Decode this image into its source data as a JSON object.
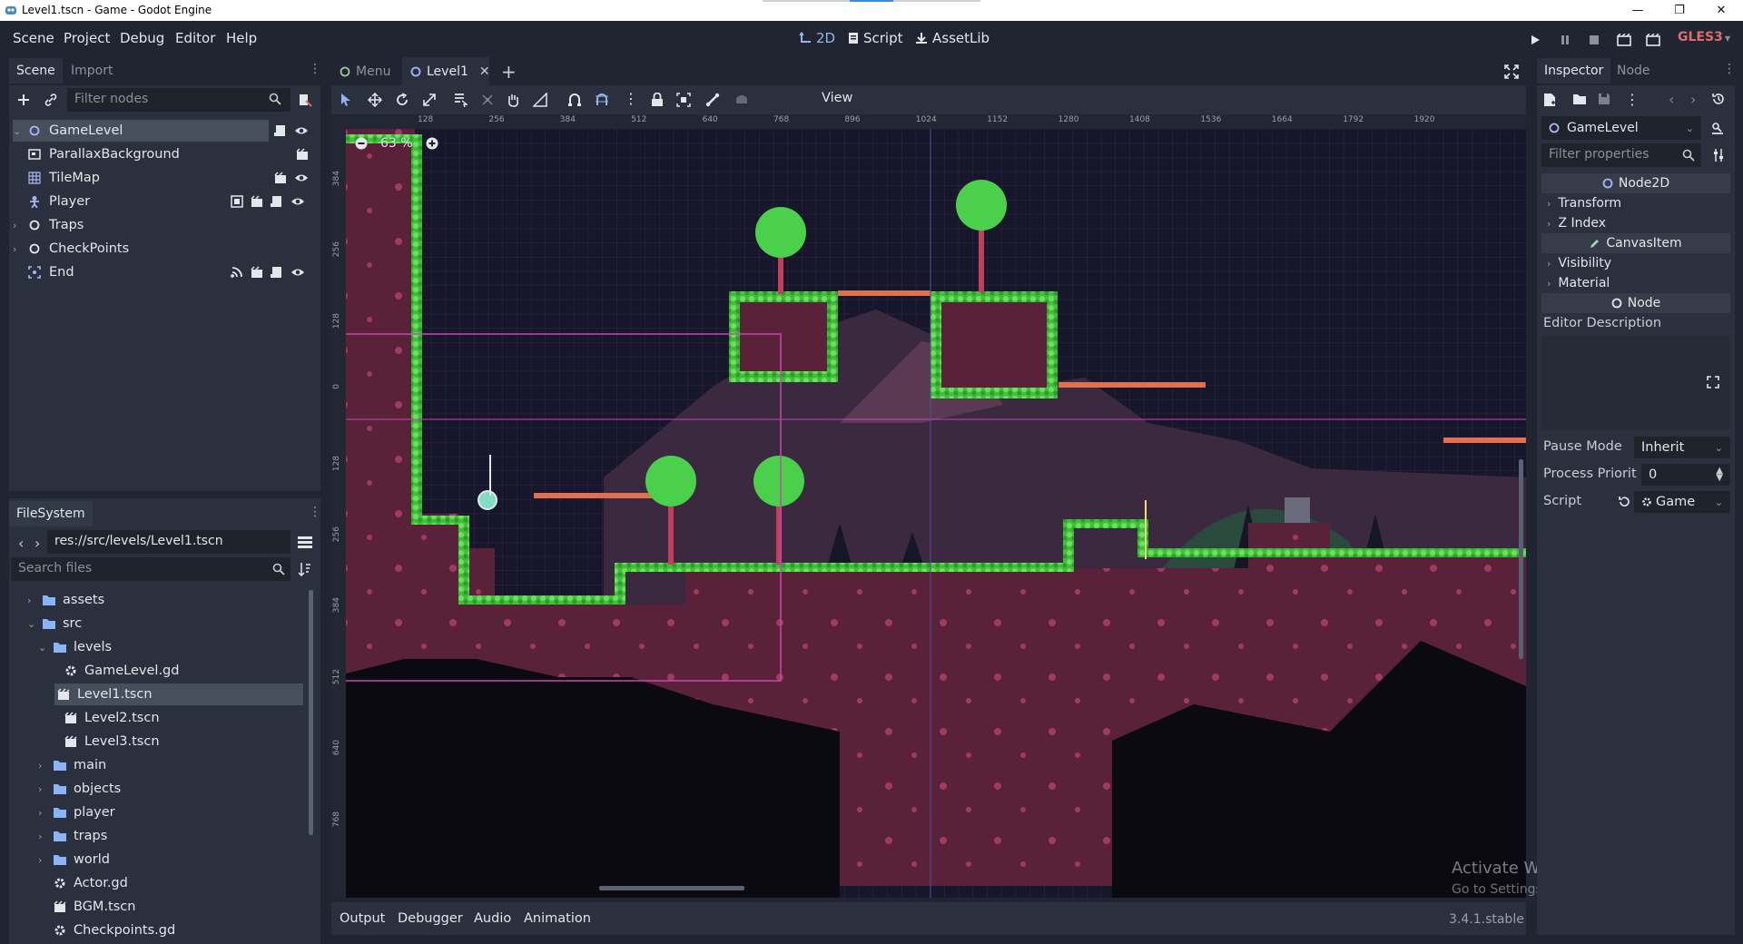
{
  "window": {
    "title": "Level1.tscn - Game - Godot Engine"
  },
  "menu": {
    "items": [
      "Scene",
      "Project",
      "Debug",
      "Editor",
      "Help"
    ]
  },
  "workspaces": {
    "twod": "2D",
    "script": "Script",
    "assetlib": "AssetLib"
  },
  "renderer": {
    "label": "GLES3",
    "color": "#e06c6c"
  },
  "scene_dock": {
    "tabs": [
      "Scene",
      "Import"
    ],
    "filter_placeholder": "Filter nodes",
    "nodes": [
      {
        "name": "GameLevel",
        "icon": "node2d-icon"
      },
      {
        "name": "ParallaxBackground",
        "icon": "parallax-icon"
      },
      {
        "name": "TileMap",
        "icon": "tilemap-icon"
      },
      {
        "name": "Player",
        "icon": "player-icon"
      },
      {
        "name": "Traps",
        "icon": "node2d-icon"
      },
      {
        "name": "CheckPoints",
        "icon": "node2d-icon"
      },
      {
        "name": "End",
        "icon": "area-icon"
      }
    ]
  },
  "filesystem": {
    "tab": "FileSystem",
    "path": "res://src/levels/Level1.tscn",
    "search_placeholder": "Search files",
    "items": [
      {
        "name": "assets",
        "type": "folder"
      },
      {
        "name": "src",
        "type": "folder"
      },
      {
        "name": "levels",
        "type": "folder"
      },
      {
        "name": "GameLevel.gd",
        "type": "script"
      },
      {
        "name": "Level1.tscn",
        "type": "scene"
      },
      {
        "name": "Level2.tscn",
        "type": "scene"
      },
      {
        "name": "Level3.tscn",
        "type": "scene"
      },
      {
        "name": "main",
        "type": "folder"
      },
      {
        "name": "objects",
        "type": "folder"
      },
      {
        "name": "player",
        "type": "folder"
      },
      {
        "name": "traps",
        "type": "folder"
      },
      {
        "name": "world",
        "type": "folder"
      },
      {
        "name": "Actor.gd",
        "type": "script"
      },
      {
        "name": "BGM.tscn",
        "type": "scene"
      },
      {
        "name": "Checkpoints.gd",
        "type": "script"
      }
    ]
  },
  "editor_tabs": [
    "Menu",
    "Level1"
  ],
  "toolbar": {
    "view_label": "View"
  },
  "viewport": {
    "zoom": "63 %",
    "ruler_x": [
      "128",
      "256",
      "384",
      "512",
      "640",
      "768",
      "896",
      "1024",
      "1152",
      "1280",
      "1408",
      "1536",
      "1664",
      "1792",
      "1920"
    ],
    "ruler_y": [
      "384",
      "256",
      "128",
      "0",
      "128",
      "256",
      "384",
      "512",
      "640",
      "768"
    ],
    "watermark_title": "Activate Windows",
    "watermark_sub": "Go to Settings to activate Windows."
  },
  "bottom_panel": {
    "tabs": [
      "Output",
      "Debugger",
      "Audio",
      "Animation"
    ],
    "version": "3.4.1.stable"
  },
  "inspector": {
    "tabs": [
      "Inspector",
      "Node"
    ],
    "object": "GameLevel",
    "filter_placeholder": "Filter properties",
    "sections": {
      "node2d": "Node2D",
      "canvasitem": "CanvasItem",
      "node": "Node"
    },
    "groups": {
      "transform": "Transform",
      "zindex": "Z Index",
      "visibility": "Visibility",
      "material": "Material"
    },
    "editor_description": "Editor Description",
    "pause_mode": {
      "label": "Pause Mode",
      "value": "Inherit"
    },
    "process_priority": {
      "label": "Process Priorit",
      "value": "0"
    },
    "script": {
      "label": "Script",
      "value": "Game"
    }
  }
}
